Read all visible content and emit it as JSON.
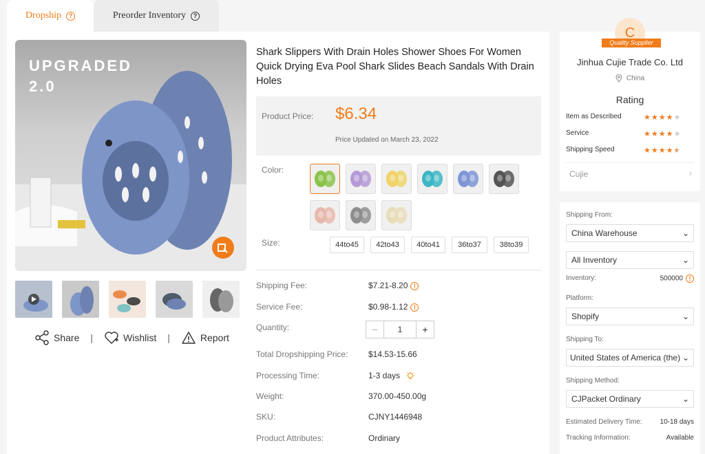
{
  "tabs": [
    {
      "label": "Dropship"
    },
    {
      "label": "Preorder Inventory"
    }
  ],
  "product": {
    "title": "Shark Slippers With Drain Holes Shower Shoes For Women Quick Drying Eva Pool Shark Slides Beach Sandals With Drain Holes",
    "image_text": "UPGRADED\n2.0",
    "price_label": "Product Price:",
    "price": "$6.34",
    "price_updated": "Price Updated on March 23, 2022",
    "color_label": "Color:",
    "colors": [
      "#8bc34a",
      "#b49ad6",
      "#f0d36a",
      "#3bb6c4",
      "#7e95d6",
      "#555555",
      "#e7b8ad",
      "#8e8e8e",
      "#e7dcb8"
    ],
    "size_label": "Size:",
    "sizes": [
      "44to45",
      "42to43",
      "40to41",
      "36to37",
      "38to39"
    ]
  },
  "actions": {
    "share": "Share",
    "wishlist": "Wishlist",
    "report": "Report"
  },
  "details": {
    "shipping_fee_label": "Shipping Fee:",
    "shipping_fee": "$7.21-8.20",
    "service_fee_label": "Service Fee:",
    "service_fee": "$0.98-1.12",
    "quantity_label": "Quantity:",
    "quantity": "1",
    "total_label": "Total Dropshipping Price:",
    "total": "$14.53-15.66",
    "processing_label": "Processing Time:",
    "processing": "1-3 days",
    "weight_label": "Weight:",
    "weight": "370.00-450.00g",
    "sku_label": "SKU:",
    "sku": "CJNY1446948",
    "attributes_label": "Product Attributes:",
    "attributes": "Ordinary"
  },
  "supplier": {
    "initial": "C",
    "badge": "Quality Supplier",
    "name": "Jinhua Cujie Trade Co. Ltd",
    "country": "China",
    "rating_title": "Rating",
    "ratings": [
      {
        "label": "Item as Described",
        "stars": 4
      },
      {
        "label": "Service",
        "stars": 4
      },
      {
        "label": "Shipping Speed",
        "stars": 4.5
      }
    ],
    "store": "Cujie"
  },
  "shipping": {
    "from_label": "Shipping From:",
    "from": "China Warehouse",
    "inventory_select": "All Inventory",
    "inventory_label": "Inventory:",
    "inventory": "500000",
    "platform_label": "Platform:",
    "platform": "Shopify",
    "to_label": "Shipping To:",
    "to": "United States of America (the)",
    "method_label": "Shipping Method:",
    "method": "CJPacket Ordinary",
    "delivery_label": "Estimated Delivery Time:",
    "delivery": "10-18 days",
    "tracking_label": "Tracking Information:",
    "tracking": "Available"
  },
  "colors": {
    "accent": "#f07c1a"
  }
}
